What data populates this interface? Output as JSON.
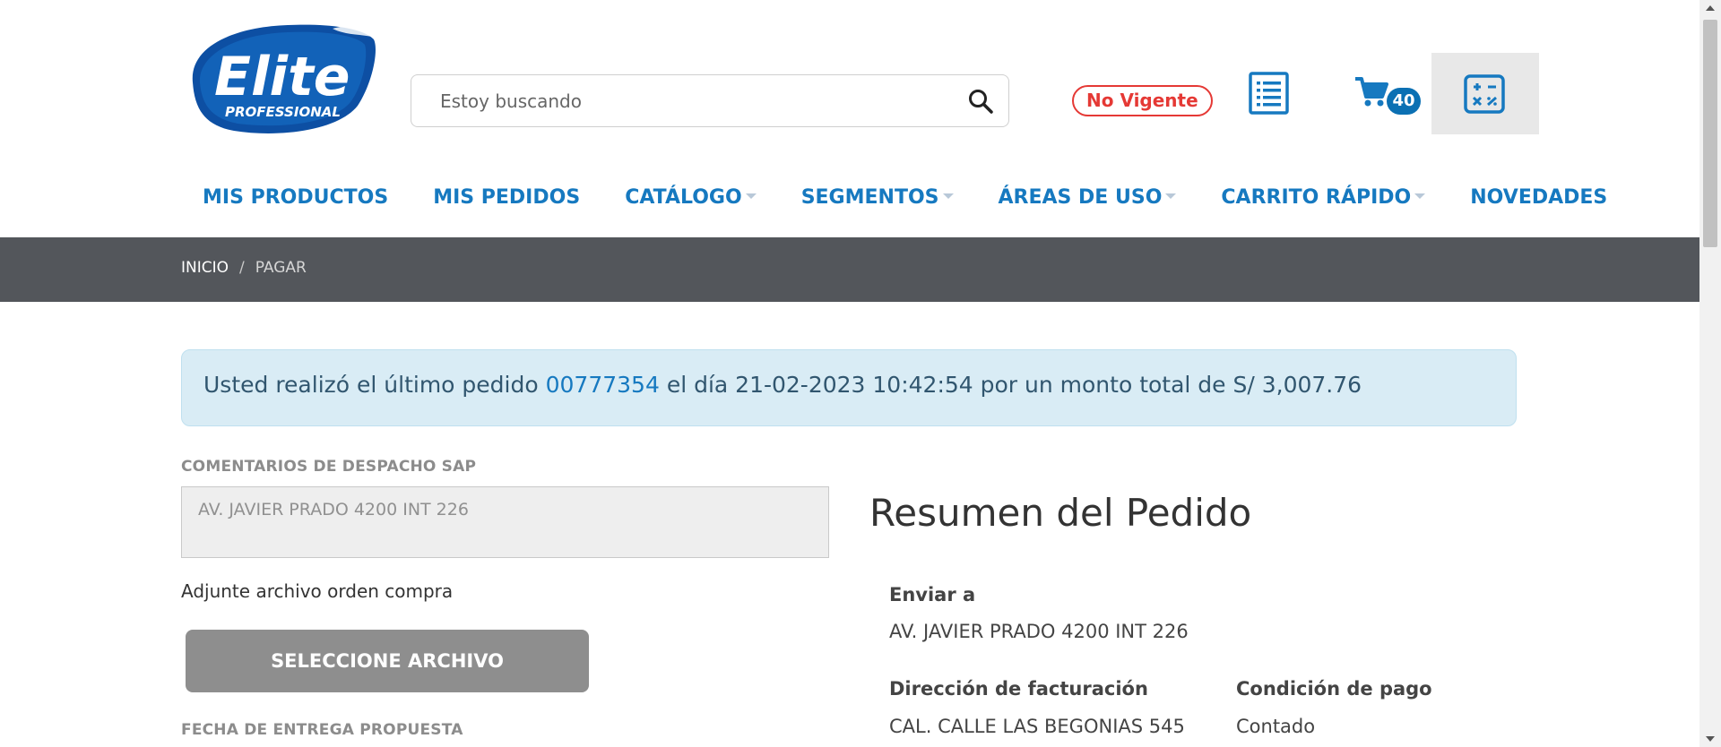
{
  "header": {
    "logo_text": "Elite",
    "logo_subtext": "PROFESSIONAL",
    "search_placeholder": "Estoy buscando",
    "status_badge": "No Vigente",
    "cart_count": "40",
    "brand_color": "#1679c0",
    "alert_color": "#e53935"
  },
  "nav": {
    "items": [
      {
        "label": "MIS PRODUCTOS"
      },
      {
        "label": "MIS PEDIDOS"
      },
      {
        "label": "CATÁLOGO"
      },
      {
        "label": "SEGMENTOS"
      },
      {
        "label": "ÁREAS DE USO"
      },
      {
        "label": "CARRITO RÁPIDO"
      },
      {
        "label": "NOVEDADES"
      }
    ]
  },
  "breadcrumb": {
    "home": "INICIO",
    "separator": "/",
    "current": "PAGAR"
  },
  "alert": {
    "prefix": "Usted realizó el último pedido",
    "order_number": "00777354",
    "suffix": "el día 21-02-2023 10:42:54 por un monto total de S/ 3,007.76"
  },
  "form": {
    "comments_label": "COMENTARIOS DE DESPACHO SAP",
    "comments_value": "AV. JAVIER PRADO 4200 INT 226",
    "attach_label": "Adjunte archivo orden compra",
    "select_file_button": "SELECCIONE ARCHIVO",
    "delivery_date_label": "FECHA DE ENTREGA PROPUESTA"
  },
  "summary": {
    "title": "Resumen del Pedido",
    "ship_to_label": "Enviar a",
    "ship_to_value": "AV. JAVIER PRADO 4200 INT 226",
    "billing_label": "Dirección de facturación",
    "billing_value": "CAL. CALLE LAS BEGONIAS 545",
    "payment_label": "Condición de pago",
    "payment_value": "Contado"
  }
}
